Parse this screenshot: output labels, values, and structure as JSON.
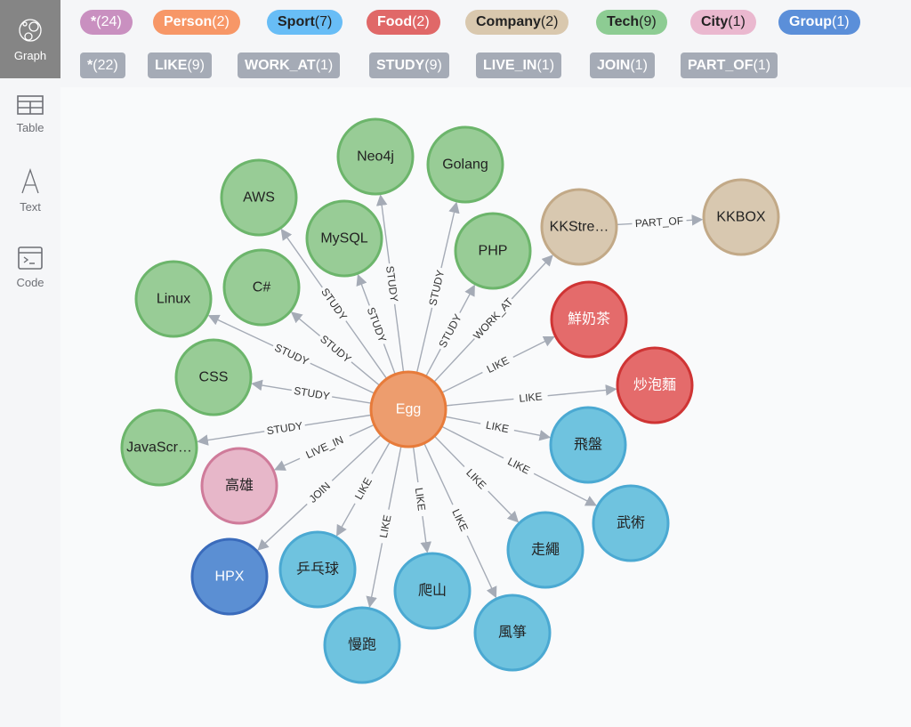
{
  "sidebar": {
    "items": [
      {
        "label": "Graph",
        "icon": "graph-icon",
        "active": true
      },
      {
        "label": "Table",
        "icon": "table-icon",
        "active": false
      },
      {
        "label": "Text",
        "icon": "text-icon",
        "active": false
      },
      {
        "label": "Code",
        "icon": "code-icon",
        "active": false
      }
    ]
  },
  "node_labels": [
    {
      "name": "*",
      "count": "(24)",
      "bg": "#c990c0",
      "fg": "#ffffff"
    },
    {
      "name": "Person",
      "count": "(2)",
      "bg": "#f79767",
      "fg": "#ffffff"
    },
    {
      "name": "Sport",
      "count": "(7)",
      "bg": "#68bdf6",
      "fg": "#222222"
    },
    {
      "name": "Food",
      "count": "(2)",
      "bg": "#e06868",
      "fg": "#ffffff"
    },
    {
      "name": "Company",
      "count": "(2)",
      "bg": "#d9c8ae",
      "fg": "#222222"
    },
    {
      "name": "Tech",
      "count": "(9)",
      "bg": "#8dcc93",
      "fg": "#222222"
    },
    {
      "name": "City",
      "count": "(1)",
      "bg": "#eab8cf",
      "fg": "#222222"
    },
    {
      "name": "Group",
      "count": "(1)",
      "bg": "#5b8fd9",
      "fg": "#ffffff"
    }
  ],
  "relationship_types": [
    {
      "name": "*",
      "count": "(22)"
    },
    {
      "name": "LIKE",
      "count": "(9)"
    },
    {
      "name": "WORK_AT",
      "count": "(1)"
    },
    {
      "name": "STUDY",
      "count": "(9)"
    },
    {
      "name": "LIVE_IN",
      "count": "(1)"
    },
    {
      "name": "JOIN",
      "count": "(1)"
    },
    {
      "name": "PART_OF",
      "count": "(1)"
    }
  ],
  "colors": {
    "Person": {
      "fill": "#ed9d6e",
      "stroke": "#e77b3a",
      "text": "#ffffff"
    },
    "Tech": {
      "fill": "#98cc96",
      "stroke": "#6cb56b",
      "text": "#222222"
    },
    "Company": {
      "fill": "#d8c8b0",
      "stroke": "#c2a987",
      "text": "#222222"
    },
    "Food": {
      "fill": "#e46b6b",
      "stroke": "#cf3434",
      "text": "#ffffff"
    },
    "Sport": {
      "fill": "#6fc3df",
      "stroke": "#4ba9d2",
      "text": "#222222"
    },
    "City": {
      "fill": "#e7b7c9",
      "stroke": "#cf7b9a",
      "text": "#222222"
    },
    "Group": {
      "fill": "#5b8fd3",
      "stroke": "#3a6bbb",
      "text": "#ffffff"
    },
    "edge": "#a5abb6"
  },
  "graph": {
    "nodes": [
      {
        "id": "egg",
        "label": "Egg",
        "type": "Person"
      },
      {
        "id": "neo4j",
        "label": "Neo4j",
        "type": "Tech"
      },
      {
        "id": "golang",
        "label": "Golang",
        "type": "Tech"
      },
      {
        "id": "aws",
        "label": "AWS",
        "type": "Tech"
      },
      {
        "id": "mysql",
        "label": "MySQL",
        "type": "Tech"
      },
      {
        "id": "php",
        "label": "PHP",
        "type": "Tech"
      },
      {
        "id": "csharp",
        "label": "C#",
        "type": "Tech"
      },
      {
        "id": "linux",
        "label": "Linux",
        "type": "Tech"
      },
      {
        "id": "css",
        "label": "CSS",
        "type": "Tech"
      },
      {
        "id": "javascript",
        "label": "JavaScr…",
        "type": "Tech"
      },
      {
        "id": "kkstream",
        "label": "KKStre…",
        "type": "Company"
      },
      {
        "id": "kkbox",
        "label": "KKBOX",
        "type": "Company"
      },
      {
        "id": "milktea",
        "label": "鮮奶茶",
        "type": "Food"
      },
      {
        "id": "noodle",
        "label": "炒泡麵",
        "type": "Food"
      },
      {
        "id": "frisbee",
        "label": "飛盤",
        "type": "Sport"
      },
      {
        "id": "wushu",
        "label": "武術",
        "type": "Sport"
      },
      {
        "id": "tightrope",
        "label": "走繩",
        "type": "Sport"
      },
      {
        "id": "kite",
        "label": "風箏",
        "type": "Sport"
      },
      {
        "id": "hiking",
        "label": "爬山",
        "type": "Sport"
      },
      {
        "id": "jogging",
        "label": "慢跑",
        "type": "Sport"
      },
      {
        "id": "pingpong",
        "label": "乒乓球",
        "type": "Sport"
      },
      {
        "id": "kaohsiung",
        "label": "高雄",
        "type": "City"
      },
      {
        "id": "hpx",
        "label": "HPX",
        "type": "Group"
      }
    ],
    "edges": [
      {
        "from": "egg",
        "to": "neo4j",
        "label": "STUDY"
      },
      {
        "from": "egg",
        "to": "golang",
        "label": "STUDY"
      },
      {
        "from": "egg",
        "to": "aws",
        "label": "STUDY"
      },
      {
        "from": "egg",
        "to": "mysql",
        "label": "STUDY"
      },
      {
        "from": "egg",
        "to": "php",
        "label": "STUDY"
      },
      {
        "from": "egg",
        "to": "csharp",
        "label": "STUDY"
      },
      {
        "from": "egg",
        "to": "linux",
        "label": "STUDY"
      },
      {
        "from": "egg",
        "to": "css",
        "label": "STUDY"
      },
      {
        "from": "egg",
        "to": "javascript",
        "label": "STUDY"
      },
      {
        "from": "egg",
        "to": "kkstream",
        "label": "WORK_AT"
      },
      {
        "from": "kkstream",
        "to": "kkbox",
        "label": "PART_OF"
      },
      {
        "from": "egg",
        "to": "milktea",
        "label": "LIKE"
      },
      {
        "from": "egg",
        "to": "noodle",
        "label": "LIKE"
      },
      {
        "from": "egg",
        "to": "frisbee",
        "label": "LIKE"
      },
      {
        "from": "egg",
        "to": "wushu",
        "label": "LIKE"
      },
      {
        "from": "egg",
        "to": "tightrope",
        "label": "LIKE"
      },
      {
        "from": "egg",
        "to": "kite",
        "label": "LIKE"
      },
      {
        "from": "egg",
        "to": "hiking",
        "label": "LIKE"
      },
      {
        "from": "egg",
        "to": "jogging",
        "label": "LIKE"
      },
      {
        "from": "egg",
        "to": "pingpong",
        "label": "LIKE"
      },
      {
        "from": "egg",
        "to": "kaohsiung",
        "label": "LIVE_IN"
      },
      {
        "from": "egg",
        "to": "hpx",
        "label": "JOIN"
      }
    ]
  }
}
